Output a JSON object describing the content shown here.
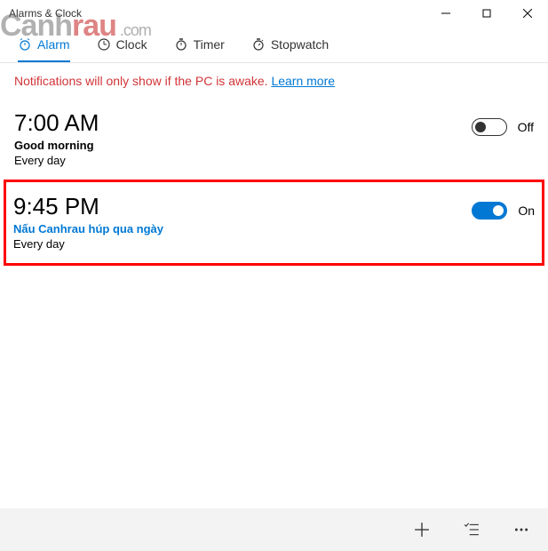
{
  "window": {
    "title": "Alarms & Clock"
  },
  "tabs": {
    "alarm": "Alarm",
    "clock": "Clock",
    "timer": "Timer",
    "stopwatch": "Stopwatch"
  },
  "notice": {
    "text": "Notifications will only show if the PC is awake. ",
    "link": "Learn more"
  },
  "alarms": [
    {
      "time": "7:00 AM",
      "name": "Good morning",
      "repeat": "Every day",
      "state": "Off",
      "on": false
    },
    {
      "time": "9:45 PM",
      "name": "Nấu Canhrau húp qua ngày",
      "repeat": "Every day",
      "state": "On",
      "on": true
    }
  ],
  "watermark": {
    "p1": "Canh",
    "p2": "r",
    "p3": "au",
    "p4": " .com"
  }
}
